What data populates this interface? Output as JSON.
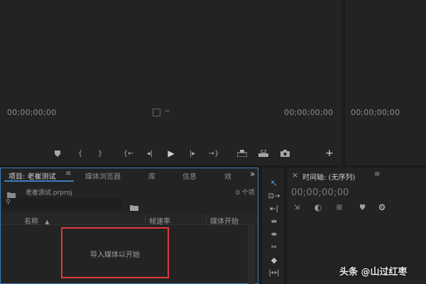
{
  "source_monitor": {
    "timecode_left": "00;00;00;00",
    "timecode_right": "00;00;00;00"
  },
  "program_monitor": {
    "timecode_left": "00;00;00;00"
  },
  "project_panel": {
    "tabs": [
      {
        "label": "项目: 老崔测试"
      },
      {
        "label": "媒体浏览器"
      },
      {
        "label": "库"
      },
      {
        "label": "信息"
      },
      {
        "label": "效"
      }
    ],
    "menu_glyph": "≡",
    "overflow_glyph": "»",
    "file_name": "老崔测试.prproj",
    "item_count": "0 个项",
    "search": {
      "value": "",
      "placeholder": ""
    },
    "columns": {
      "name": "名称",
      "frame_rate": "帧速率",
      "media_start": "媒体开始"
    },
    "empty_message": "导入媒体以开始"
  },
  "timeline_panel": {
    "title": "时间轴: (无序列)",
    "menu_glyph": "≡",
    "close_glyph": "×",
    "timecode": "00;00;00;00"
  },
  "watermark": {
    "text": "头条 @山过红枣"
  },
  "colors": {
    "highlight_box": "#e03a3a",
    "active_border": "#3a7fc0",
    "tool_selected": "#5aa0ea"
  }
}
